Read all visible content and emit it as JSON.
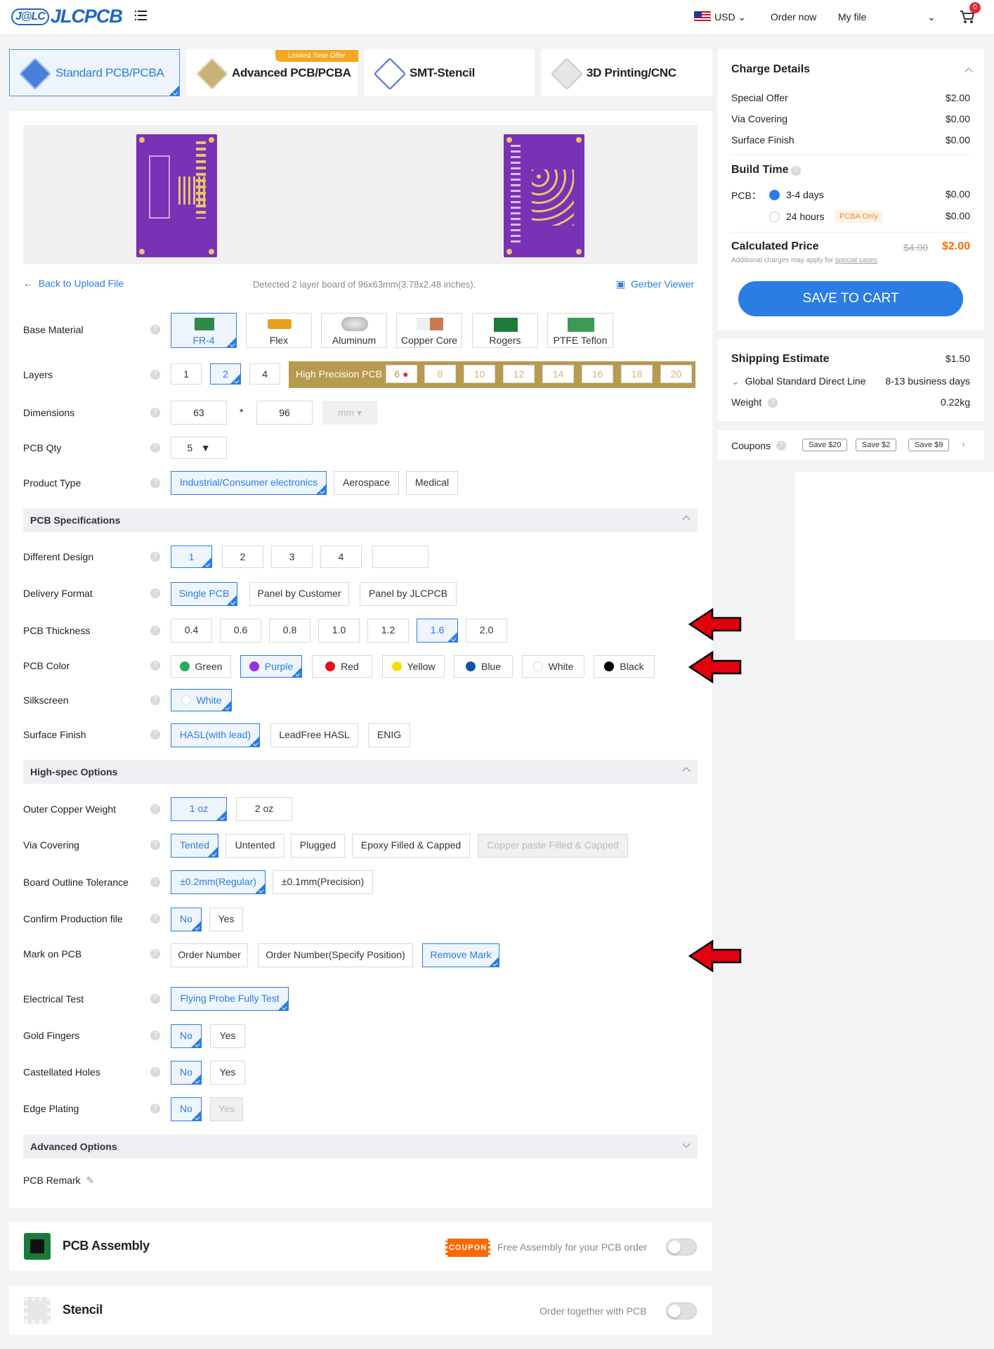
{
  "header": {
    "logo": "JLCPCB",
    "logo_prefix": "J@LC",
    "currency": "USD",
    "order_now": "Order now",
    "my_file": "My file",
    "cart_count": "0"
  },
  "tabs": [
    {
      "label": "Standard PCB/PCBA"
    },
    {
      "label": "Advanced PCB/PCBA",
      "ribbon": "Limited Time Offer"
    },
    {
      "label": "SMT-Stencil"
    },
    {
      "label": "3D Printing/CNC"
    }
  ],
  "upload": {
    "back": "Back to Upload File",
    "detected": "Detected 2 layer board of 96x63mm(3.78x2.48 inches).",
    "gerber": "Gerber Viewer"
  },
  "form": {
    "base_material": {
      "label": "Base Material",
      "options": [
        "FR-4",
        "Flex",
        "Aluminum",
        "Copper Core",
        "Rogers",
        "PTFE Teflon"
      ]
    },
    "layers": {
      "label": "Layers",
      "options": [
        "1",
        "2",
        "4"
      ],
      "hp_label": "High Precision PCB",
      "hp_options": [
        "6",
        "8",
        "10",
        "12",
        "14",
        "16",
        "18",
        "20"
      ]
    },
    "dimensions": {
      "label": "Dimensions",
      "w": "63",
      "x": "*",
      "h": "96",
      "unit": "mm"
    },
    "qty": {
      "label": "PCB Qty",
      "value": "5"
    },
    "product_type": {
      "label": "Product Type",
      "options": [
        "Industrial/Consumer electronics",
        "Aerospace",
        "Medical"
      ]
    },
    "spec_section": "PCB Specifications",
    "diff_design": {
      "label": "Different Design",
      "options": [
        "1",
        "2",
        "3",
        "4"
      ]
    },
    "delivery": {
      "label": "Delivery Format",
      "options": [
        "Single PCB",
        "Panel by Customer",
        "Panel by JLCPCB"
      ]
    },
    "thickness": {
      "label": "PCB Thickness",
      "options": [
        "0.4",
        "0.6",
        "0.8",
        "1.0",
        "1.2",
        "1.6",
        "2.0"
      ]
    },
    "color": {
      "label": "PCB Color",
      "options": [
        "Green",
        "Purple",
        "Red",
        "Yellow",
        "Blue",
        "White",
        "Black"
      ],
      "swatches": [
        "#2daa5f",
        "#9b30d9",
        "#e8101c",
        "#f5e000",
        "#1353a8",
        "#ffffff",
        "#000000"
      ]
    },
    "silkscreen": {
      "label": "Silkscreen",
      "value": "White"
    },
    "surface": {
      "label": "Surface Finish",
      "options": [
        "HASL(with lead)",
        "LeadFree HASL",
        "ENIG"
      ]
    },
    "highspec_section": "High-spec Options",
    "copper": {
      "label": "Outer Copper Weight",
      "options": [
        "1 oz",
        "2 oz"
      ]
    },
    "via": {
      "label": "Via Covering",
      "options": [
        "Tented",
        "Untented",
        "Plugged",
        "Epoxy Filled & Capped",
        "Copper paste Filled & Capped"
      ]
    },
    "tolerance": {
      "label": "Board Outline Tolerance",
      "options": [
        "±0.2mm(Regular)",
        "±0.1mm(Precision)"
      ]
    },
    "confirm": {
      "label": "Confirm Production file",
      "options": [
        "No",
        "Yes"
      ]
    },
    "mark": {
      "label": "Mark on PCB",
      "options": [
        "Order Number",
        "Order Number(Specify Position)",
        "Remove Mark"
      ]
    },
    "etest": {
      "label": "Electrical Test",
      "value": "Flying Probe Fully Test"
    },
    "gold": {
      "label": "Gold Fingers",
      "options": [
        "No",
        "Yes"
      ]
    },
    "castellated": {
      "label": "Castellated Holes",
      "options": [
        "No",
        "Yes"
      ]
    },
    "edge": {
      "label": "Edge Plating",
      "options": [
        "No",
        "Yes"
      ]
    },
    "advanced_section": "Advanced Options",
    "remark": "PCB Remark"
  },
  "assembly": {
    "title": "PCB Assembly",
    "coupon": "COUPON",
    "text": "Free Assembly for your PCB order"
  },
  "stencil": {
    "title": "Stencil",
    "text": "Order together with PCB"
  },
  "charges": {
    "title": "Charge Details",
    "rows": [
      {
        "k": "Special Offer",
        "v": "$2.00"
      },
      {
        "k": "Via Covering",
        "v": "$0.00"
      },
      {
        "k": "Surface Finish",
        "v": "$0.00"
      }
    ],
    "build_title": "Build Time",
    "pcb": "PCB：",
    "bt1": "3-4 days",
    "bt1v": "$0.00",
    "bt2": "24 hours",
    "bt2tag": "PCBA Only",
    "bt2v": "$0.00",
    "calc": "Calculated Price",
    "old": "$4.00",
    "new": "$2.00",
    "note": "Additional charges may apply for",
    "note_link": "special cases",
    "save": "SAVE TO CART"
  },
  "shipping": {
    "title": "Shipping Estimate",
    "price": "$1.50",
    "method": "Global Standard Direct Line",
    "days": "8-13 business days",
    "weight_label": "Weight",
    "weight": "0.22kg"
  },
  "coupons": {
    "label": "Coupons",
    "items": [
      "Save $20",
      "Save $2",
      "Save $9"
    ]
  },
  "colors": {
    "accent": "#2b7de3",
    "orange": "#ff6a00",
    "arrow": "#e3000f"
  }
}
